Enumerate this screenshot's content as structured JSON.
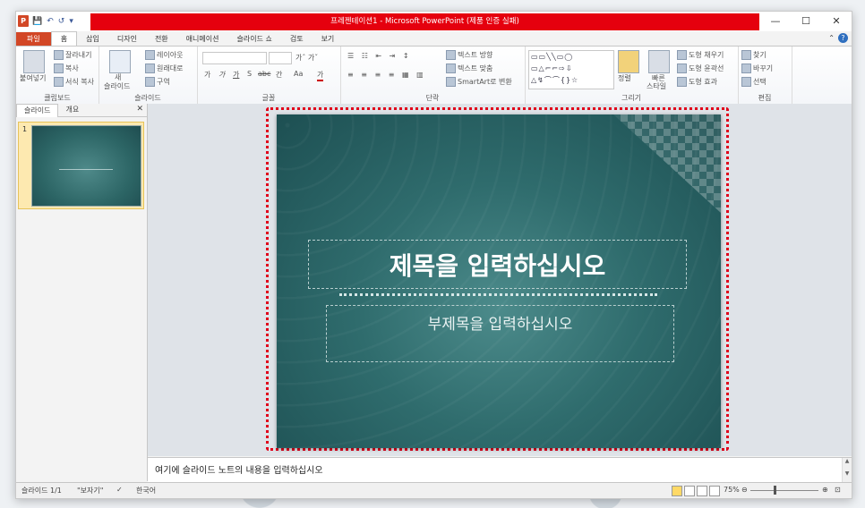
{
  "window": {
    "app_icon": "P",
    "title": "프레젠테이션1 - Microsoft PowerPoint (제품 인증 실패)",
    "controls": {
      "minimize": "—",
      "maximize": "☐",
      "close": "✕"
    }
  },
  "qat": {
    "save_icon": "💾",
    "undo": "↶",
    "redo": "↺",
    "customize": "▾"
  },
  "tabs": [
    "파일",
    "홈",
    "삽입",
    "디자인",
    "전환",
    "애니메이션",
    "슬라이드 쇼",
    "검토",
    "보기"
  ],
  "ribbon": {
    "clipboard": {
      "paste": "붙여넣기",
      "cut": "잘라내기",
      "copy": "복사",
      "format_painter": "서식 복사",
      "label": "클립보드"
    },
    "slides": {
      "new_slide": "새",
      "new_slide2": "슬라이드",
      "layout": "레이아웃",
      "reset": "원래대로",
      "section": "구역",
      "label": "슬라이드"
    },
    "font": {
      "label": "글꼴",
      "bold": "가",
      "italic": "가",
      "underline": "가",
      "shadow": "S",
      "strike": "abc",
      "spacing": "간",
      "case": "Aa",
      "color": "가"
    },
    "paragraph": {
      "label": "단락",
      "text_direction": "텍스트 방향",
      "align_text": "텍스트 맞춤",
      "smartart": "SmartArt로 변환"
    },
    "drawing": {
      "label": "그리기",
      "arrange": "정렬",
      "quick_styles": "빠른",
      "quick_styles2": "스타일",
      "shape_fill": "도형 채우기",
      "shape_outline": "도형 윤곽선",
      "shape_effects": "도형 효과"
    },
    "editing": {
      "label": "편집",
      "find": "찾기",
      "replace": "바꾸기",
      "select": "선택"
    }
  },
  "panel": {
    "tab_slides": "슬라이드",
    "tab_outline": "개요",
    "close": "✕",
    "slide_number": "1"
  },
  "slide": {
    "title": "제목을 입력하십시오",
    "subtitle": "부제목을 입력하십시오"
  },
  "notes": {
    "placeholder": "여기에 슬라이드 노트의 내용을 입력하십시오"
  },
  "status": {
    "slide_info": "슬라이드 1/1",
    "theme": "\"보자기\"",
    "language": "한국어",
    "zoom": "75%"
  }
}
